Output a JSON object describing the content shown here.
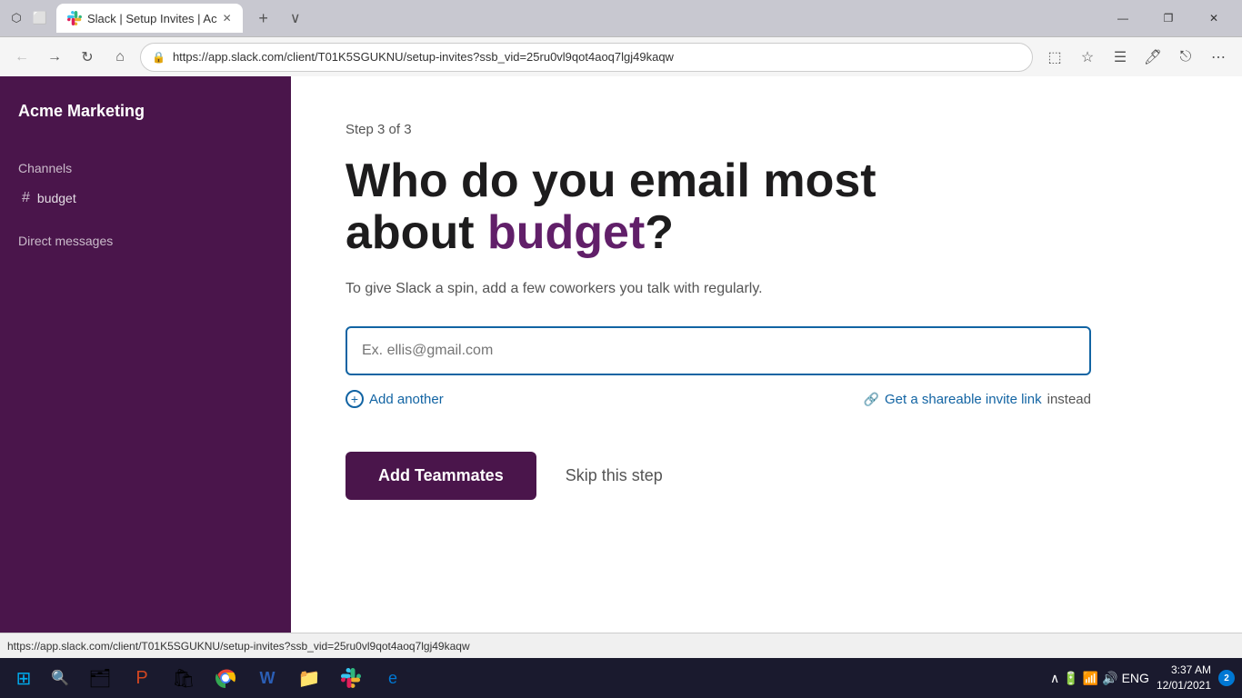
{
  "browser": {
    "tab_title": "Slack | Setup Invites | Ac",
    "url": "https://app.slack.com/client/T01K5SGUKNU/setup-invites?ssb_vid=25ru0vl9qot4aoq7lgj49kaqw",
    "close_label": "✕",
    "minimize_label": "—",
    "maximize_label": "❐",
    "new_tab_label": "+",
    "tab_list_label": "∨"
  },
  "sidebar": {
    "workspace_name": "Acme Marketing",
    "channels_label": "Channels",
    "channel_name": "budget",
    "dm_label": "Direct messages"
  },
  "content": {
    "step_label": "Step 3 of 3",
    "heading_part1": "Who do you email most",
    "heading_part2": "about ",
    "heading_highlight": "budget",
    "heading_part3": "?",
    "subtitle": "To give Slack a spin, add a few coworkers you talk with regularly.",
    "email_placeholder": "Ex. ellis@gmail.com",
    "add_another_label": "Add another",
    "invite_link_label": "Get a shareable invite link",
    "invite_link_suffix": "instead",
    "add_button_label": "Add Teammates",
    "skip_button_label": "Skip this step"
  },
  "status_bar": {
    "url": "https://app.slack.com/client/T01K5SGUKNU/setup-invites?ssb_vid=25ru0vl9qot4aoq7lgj49kaqw"
  },
  "taskbar": {
    "time": "3:37 AM",
    "date": "12/01/2021",
    "language": "ENG",
    "notification_count": "2"
  }
}
